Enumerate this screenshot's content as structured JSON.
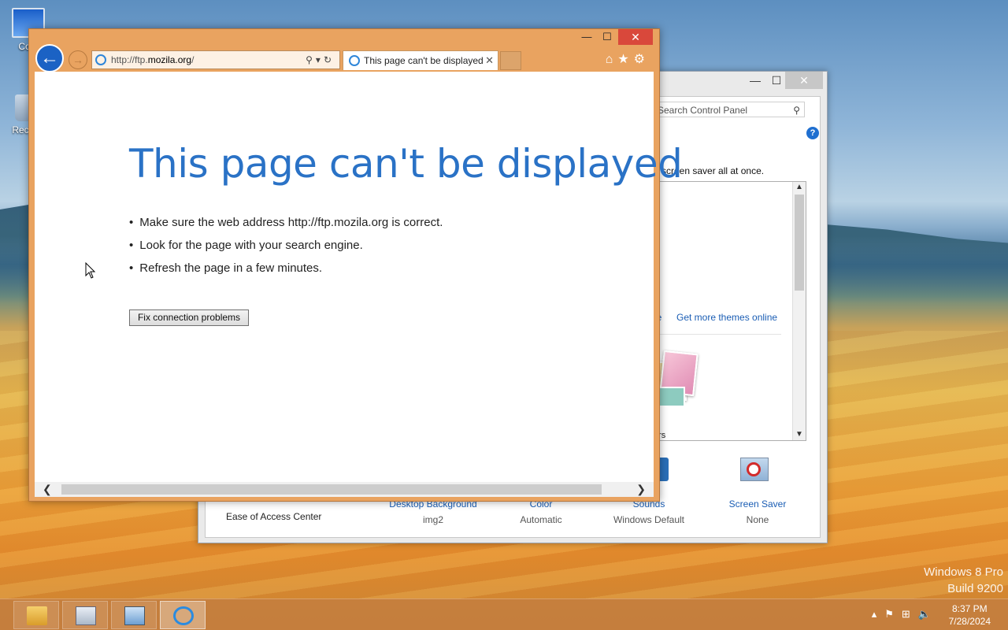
{
  "desktop": {
    "icons": [
      {
        "label": "Com"
      },
      {
        "label": "Recyc"
      }
    ],
    "watermark": {
      "line1": "Windows 8 Pro",
      "line2": "Build 9200"
    }
  },
  "control_panel": {
    "search_placeholder": "Search Control Panel",
    "help": "?",
    "description": "d screen saver all at once.",
    "themes_partial_link": "ne",
    "get_more_themes": "Get more themes online",
    "theme_caption": "ers",
    "ease_of_access": "Ease of Access Center",
    "tiles": [
      {
        "link": "Desktop Background",
        "value": "img2"
      },
      {
        "link": "Color",
        "value": "Automatic"
      },
      {
        "link": "Sounds",
        "value": "Windows Default"
      },
      {
        "link": "Screen Saver",
        "value": "None"
      }
    ],
    "window_controls": {
      "minimize": "—",
      "maximize": "☐",
      "close": "✕"
    }
  },
  "browser": {
    "address": {
      "prefix": "http://ftp.",
      "domain": "mozila.org",
      "suffix": "/"
    },
    "tab_title": "This page can't be displayed",
    "tab_close": "✕",
    "window_controls": {
      "minimize": "—",
      "maximize": "☐",
      "close": "✕"
    },
    "page": {
      "title": "This page can't be displayed",
      "bullets": [
        "Make sure the web address http://ftp.mozila.org is correct.",
        "Look for the page with your search engine.",
        "Refresh the page in a few minutes."
      ],
      "fix_button": "Fix connection problems"
    }
  },
  "taskbar": {
    "apps": [
      "file-explorer",
      "calculator",
      "control-panel",
      "internet-explorer"
    ],
    "clock": {
      "time": "8:37 PM",
      "date": "7/28/2024"
    }
  }
}
